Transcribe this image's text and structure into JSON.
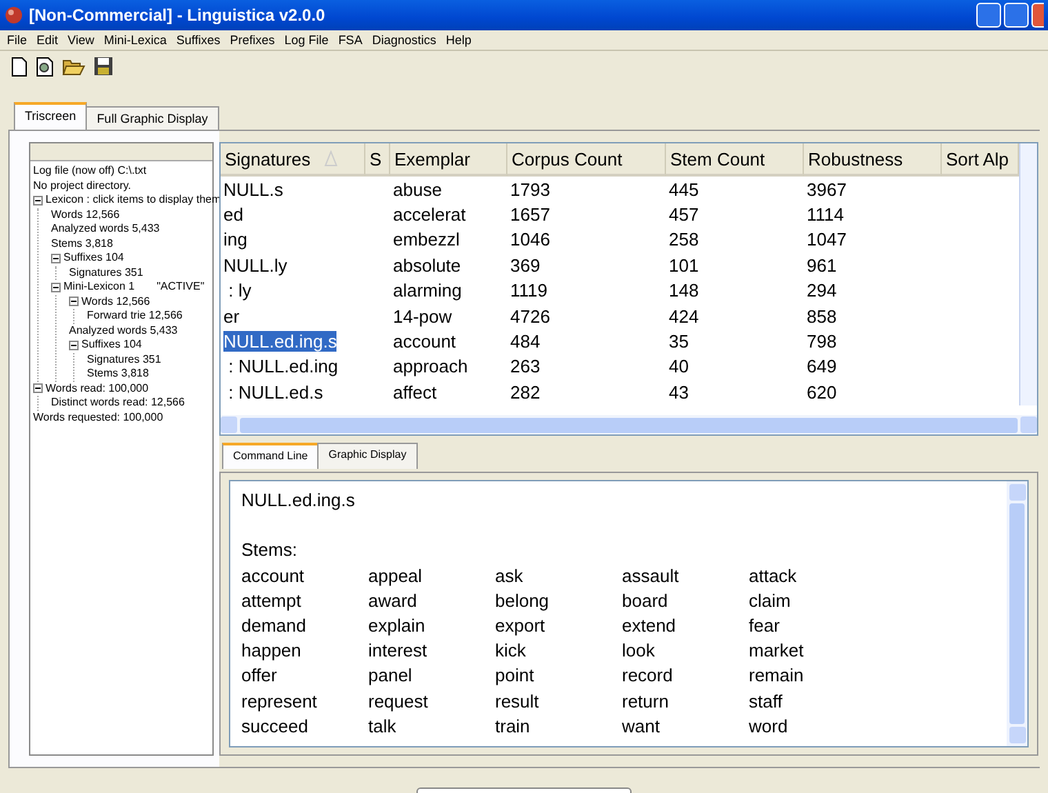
{
  "window": {
    "title": "[Non-Commercial] - Linguistica v2.0.0"
  },
  "menu": [
    "File",
    "Edit",
    "View",
    "Mini-Lexica",
    "Suffixes",
    "Prefixes",
    "Log File",
    "FSA",
    "Diagnostics",
    "Help"
  ],
  "main_tabs": [
    {
      "label": "Triscreen",
      "selected": true
    },
    {
      "label": "Full Graphic Display",
      "selected": false
    }
  ],
  "tree": [
    {
      "label": "Log file (now off) C:\\.txt"
    },
    {
      "label": "No project directory."
    },
    {
      "label": "Lexicon : click items to display them",
      "expanded": true,
      "children": [
        {
          "label": "Words 12,566"
        },
        {
          "label": "Analyzed words 5,433"
        },
        {
          "label": "Stems 3,818"
        },
        {
          "label": "Suffixes 104",
          "expanded": true,
          "children": [
            {
              "label": "Signatures 351"
            }
          ]
        },
        {
          "label": "Mini-Lexicon 1",
          "note": "\"ACTIVE\"",
          "expanded": true,
          "children": [
            {
              "label": "Words 12,566",
              "expanded": true,
              "children": [
                {
                  "label": "Forward trie 12,566"
                }
              ]
            },
            {
              "label": "Analyzed words 5,433"
            },
            {
              "label": "Suffixes 104",
              "expanded": true,
              "children": [
                {
                  "label": "Signatures 351"
                },
                {
                  "label": "Stems 3,818"
                }
              ]
            }
          ]
        }
      ]
    },
    {
      "label": "Words read: 100,000",
      "expanded": true,
      "children": [
        {
          "label": "Distinct words read: 12,566"
        }
      ]
    },
    {
      "label": "Words requested: 100,000"
    }
  ],
  "table": {
    "columns": [
      {
        "label": "Signatures",
        "sorted": true
      },
      {
        "label": "S",
        "sorted": false
      },
      {
        "label": "Exemplar",
        "sorted": false
      },
      {
        "label": "Corpus Count",
        "sorted": false
      },
      {
        "label": "Stem Count",
        "sorted": false
      },
      {
        "label": "Robustness",
        "sorted": false
      },
      {
        "label": "Sort Alp",
        "sorted": false
      }
    ],
    "rows": [
      {
        "signature": "NULL.s",
        "exemplar": "abuse",
        "corpus_count": "1793",
        "stem_count": "445",
        "robustness": "3967",
        "selected": false
      },
      {
        "signature": "ed",
        "exemplar": "accelerat",
        "corpus_count": "1657",
        "stem_count": "457",
        "robustness": "1114",
        "selected": false
      },
      {
        "signature": "ing",
        "exemplar": "embezzl",
        "corpus_count": "1046",
        "stem_count": "258",
        "robustness": "1047",
        "selected": false
      },
      {
        "signature": "NULL.ly",
        "exemplar": "absolute",
        "corpus_count": "369",
        "stem_count": "101",
        "robustness": "961",
        "selected": false
      },
      {
        "signature": " : ly",
        "exemplar": "alarming",
        "corpus_count": "1119",
        "stem_count": "148",
        "robustness": "294",
        "selected": false
      },
      {
        "signature": "er",
        "exemplar": "14-pow",
        "corpus_count": "4726",
        "stem_count": "424",
        "robustness": "858",
        "selected": false
      },
      {
        "signature": "NULL.ed.ing.s",
        "exemplar": "account",
        "corpus_count": "484",
        "stem_count": "35",
        "robustness": "798",
        "selected": true
      },
      {
        "signature": " : NULL.ed.ing",
        "exemplar": "approach",
        "corpus_count": "263",
        "stem_count": "40",
        "robustness": "649",
        "selected": false
      },
      {
        "signature": " : NULL.ed.s",
        "exemplar": "affect",
        "corpus_count": "282",
        "stem_count": "43",
        "robustness": "620",
        "selected": false
      }
    ]
  },
  "bottom_tabs": [
    {
      "label": "Command Line",
      "selected": true
    },
    {
      "label": "Graphic Display",
      "selected": false
    }
  ],
  "output": {
    "heading": "NULL.ed.ing.s",
    "stems_label": "Stems:",
    "stems": [
      "account",
      "appeal",
      "ask",
      "assault",
      "attack",
      "attempt",
      "award",
      "belong",
      "board",
      "claim",
      "demand",
      "explain",
      "export",
      "extend",
      "fear",
      "happen",
      "interest",
      "kick",
      "look",
      "market",
      "offer",
      "panel",
      "point",
      "record",
      "remain",
      "represent",
      "request",
      "result",
      "return",
      "staff",
      "succeed",
      "talk",
      "train",
      "want",
      "word"
    ]
  }
}
